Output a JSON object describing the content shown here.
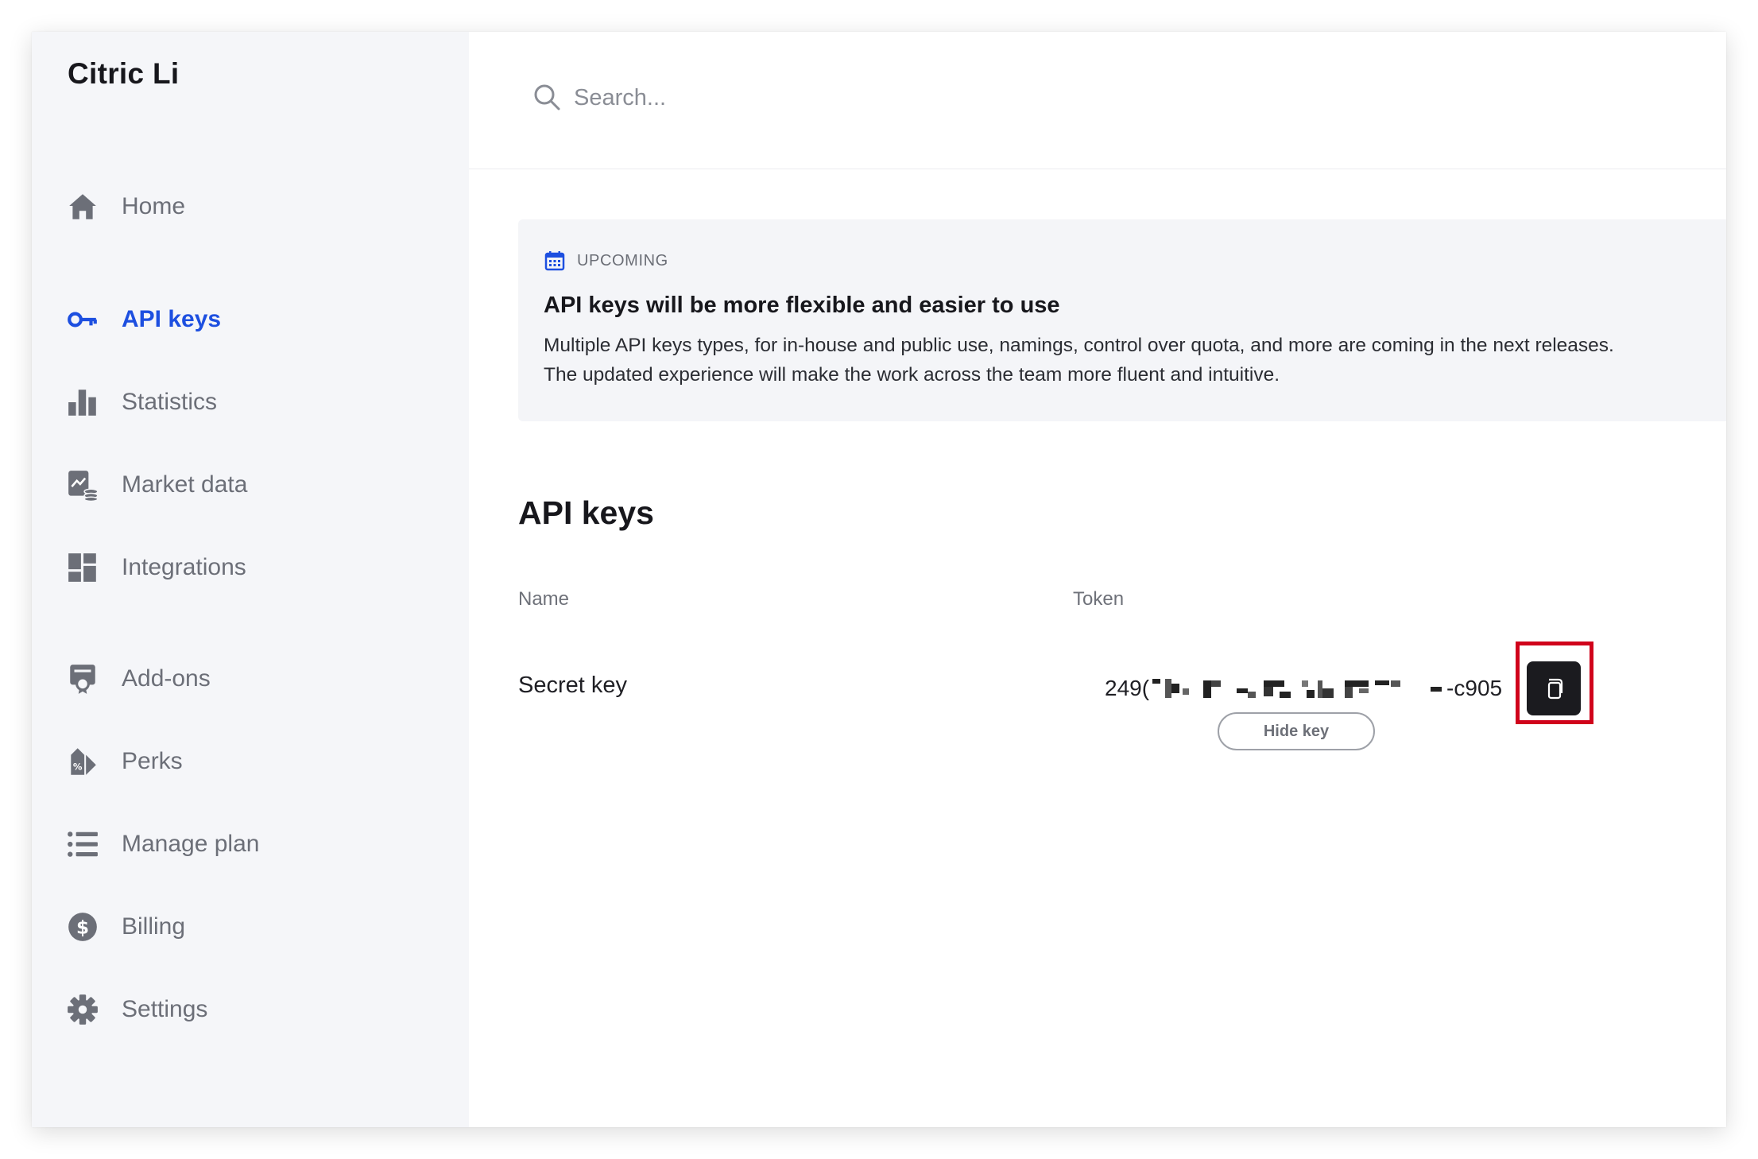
{
  "app": {
    "brand": "Citric Li"
  },
  "sidebar": {
    "items": [
      {
        "label": "Home",
        "icon": "home-icon",
        "active": false
      },
      {
        "label": "API keys",
        "icon": "key-icon",
        "active": true
      },
      {
        "label": "Statistics",
        "icon": "bar-chart-icon",
        "active": false
      },
      {
        "label": "Market data",
        "icon": "market-data-icon",
        "active": false
      },
      {
        "label": "Integrations",
        "icon": "integrations-grid-icon",
        "active": false
      },
      {
        "label": "Add-ons",
        "icon": "add-ons-icon",
        "active": false
      },
      {
        "label": "Perks",
        "icon": "perks-tag-icon",
        "active": false
      },
      {
        "label": "Manage plan",
        "icon": "list-icon",
        "active": false
      },
      {
        "label": "Billing",
        "icon": "dollar-icon",
        "active": false
      },
      {
        "label": "Settings",
        "icon": "gear-icon",
        "active": false
      }
    ]
  },
  "search": {
    "placeholder": "Search..."
  },
  "banner": {
    "tag": "UPCOMING",
    "title": "API keys will be more flexible and easier to use",
    "description_line1": "Multiple API keys types, for in-house and public use, namings, control over quota, and more are coming in the next releases.",
    "description_line2": "The updated experience will make the work across the team more fluent and intuitive."
  },
  "api_keys": {
    "title": "API keys",
    "columns": {
      "name": "Name",
      "token": "Token"
    },
    "rows": [
      {
        "name": "Secret key",
        "token_prefix": "249(",
        "token_suffix": "-c905",
        "hide_label": "Hide key"
      }
    ]
  },
  "colors": {
    "accent": "#1d4fe0",
    "highlight": "#d0021b",
    "sidebar_bg": "#f5f6f9"
  }
}
